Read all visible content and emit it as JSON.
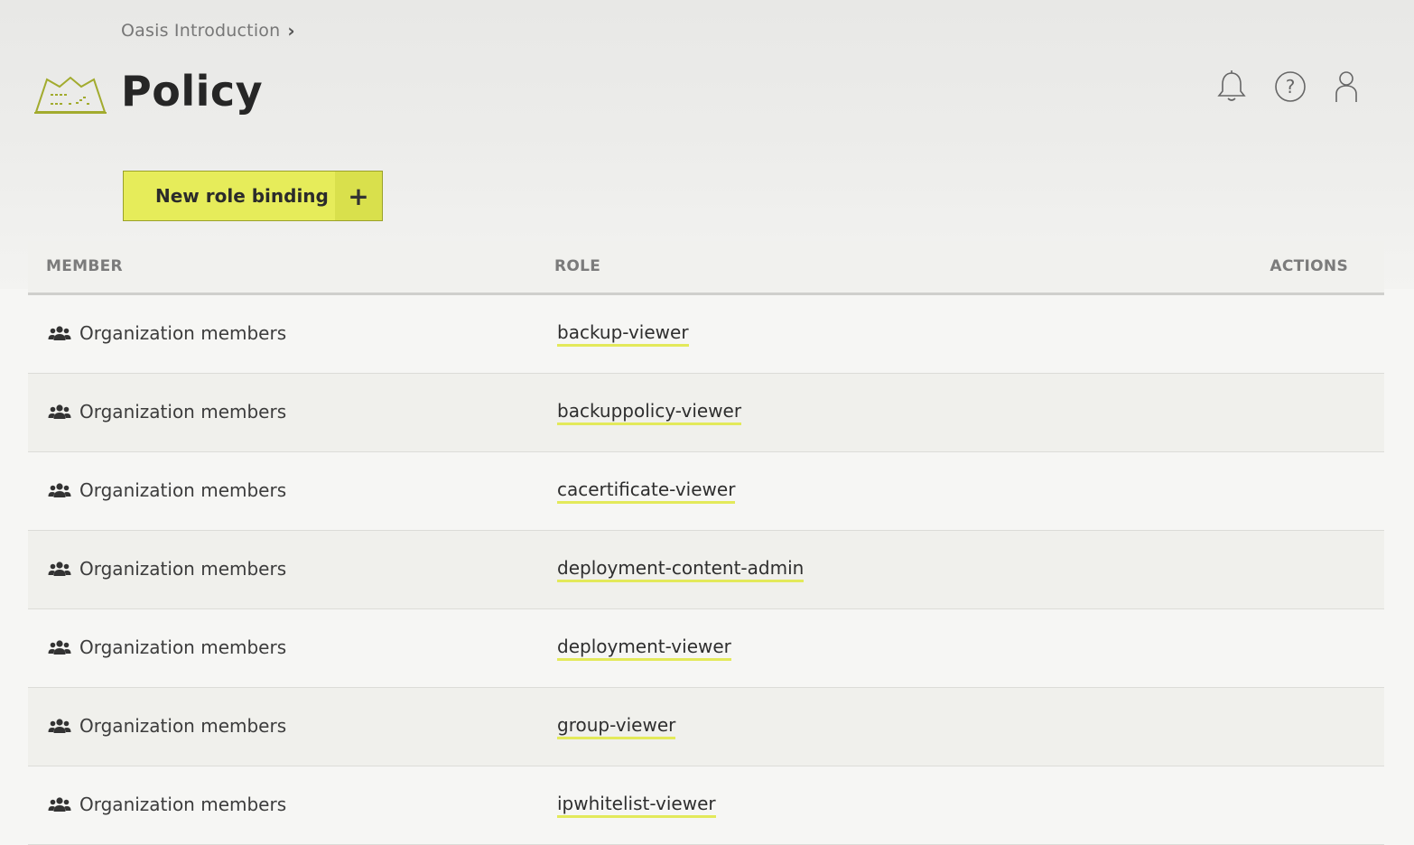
{
  "breadcrumb": {
    "parent": "Oasis Introduction",
    "separator": "›"
  },
  "page": {
    "title": "Policy"
  },
  "header_icons": [
    "bell-icon",
    "help-icon",
    "user-icon"
  ],
  "actions": {
    "new_role_binding_label": "New role binding",
    "plus_label": "+"
  },
  "table": {
    "headers": {
      "member": "MEMBER",
      "role": "ROLE",
      "actions": "ACTIONS"
    },
    "rows": [
      {
        "member": "Organization members",
        "role": "backup-viewer"
      },
      {
        "member": "Organization members",
        "role": "backuppolicy-viewer"
      },
      {
        "member": "Organization members",
        "role": "cacertificate-viewer"
      },
      {
        "member": "Organization members",
        "role": "deployment-content-admin"
      },
      {
        "member": "Organization members",
        "role": "deployment-viewer"
      },
      {
        "member": "Organization members",
        "role": "group-viewer"
      },
      {
        "member": "Organization members",
        "role": "ipwhitelist-viewer"
      }
    ]
  },
  "colors": {
    "accent": "#e6ec5a",
    "accent_dark": "#9aa12a",
    "underline": "#e3e95a"
  }
}
